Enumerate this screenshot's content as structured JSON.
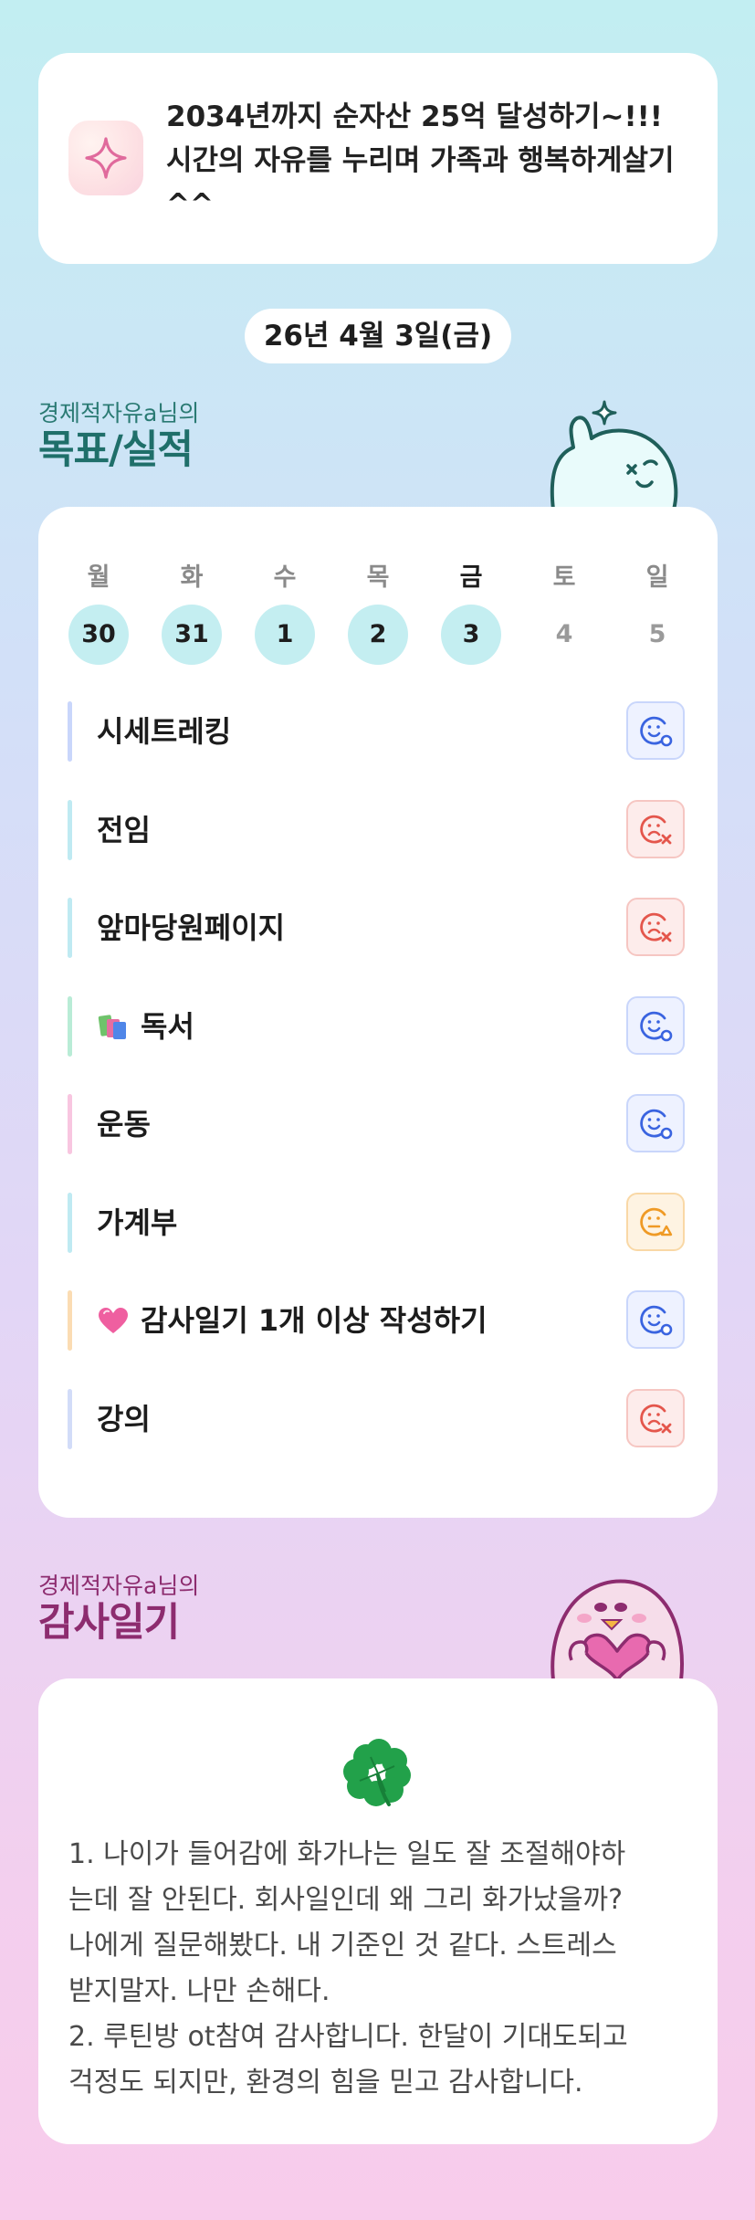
{
  "goal": {
    "icon": "sparkle-icon",
    "text": "2034년까지 순자산 25억 달성하기~!!! 시간의 자유를 누리며 가족과 행복하게살기^^"
  },
  "date": "26년 4월 3일(금)",
  "goals_section": {
    "subtitle": "경제적자유a님의",
    "title": "목표/실적"
  },
  "week": {
    "days": [
      {
        "name": "월",
        "num": "30",
        "filled": true
      },
      {
        "name": "화",
        "num": "31",
        "filled": true
      },
      {
        "name": "수",
        "num": "1",
        "filled": true
      },
      {
        "name": "목",
        "num": "2",
        "filled": true
      },
      {
        "name": "금",
        "num": "3",
        "filled": true,
        "today": true
      },
      {
        "name": "토",
        "num": "4",
        "filled": false
      },
      {
        "name": "일",
        "num": "5",
        "filled": false
      }
    ]
  },
  "habits": [
    {
      "label": "시세트레킹",
      "status": "done",
      "bar": "#c9d6fb"
    },
    {
      "label": "전임",
      "status": "failed",
      "bar": "#bfeaf2"
    },
    {
      "label": "앞마당원페이지",
      "status": "failed",
      "bar": "#bfeaf2"
    },
    {
      "label": "독서",
      "icon": "books-icon",
      "status": "done",
      "bar": "#b9ecd6"
    },
    {
      "label": "운동",
      "status": "done",
      "bar": "#f8c6e0"
    },
    {
      "label": "가계부",
      "status": "partial",
      "bar": "#bfeaf2"
    },
    {
      "label": "감사일기 1개 이상 작성하기",
      "icon": "heart-icon",
      "status": "done",
      "bar": "#fbdcb3"
    },
    {
      "label": "강의",
      "status": "failed",
      "bar": "#d2dcf8"
    }
  ],
  "diary_section": {
    "subtitle": "경제적자유a님의",
    "title": "감사일기"
  },
  "diary": {
    "icon": "clover-icon",
    "lines": [
      "1. 나이가 들어감에 화가나는 일도 잘 조절해야하",
      "는데 잘 안된다. 회사일인데 왜 그리 화가났을까?",
      "나에게 질문해봤다. 내 기준인 것 같다. 스트레스",
      "받지말자. 나만 손해다.",
      "2. 루틴방 ot참여 감사합니다. 한달이 기대도되고",
      "걱정도 되지만, 환경의 힘을 믿고 감사합니다."
    ]
  },
  "colors": {
    "goals_title": "#1f6f6a",
    "diary_title": "#8d2c6f",
    "status_done": "#3a64e0",
    "status_failed": "#e4564c",
    "status_partial": "#ef9a25"
  }
}
